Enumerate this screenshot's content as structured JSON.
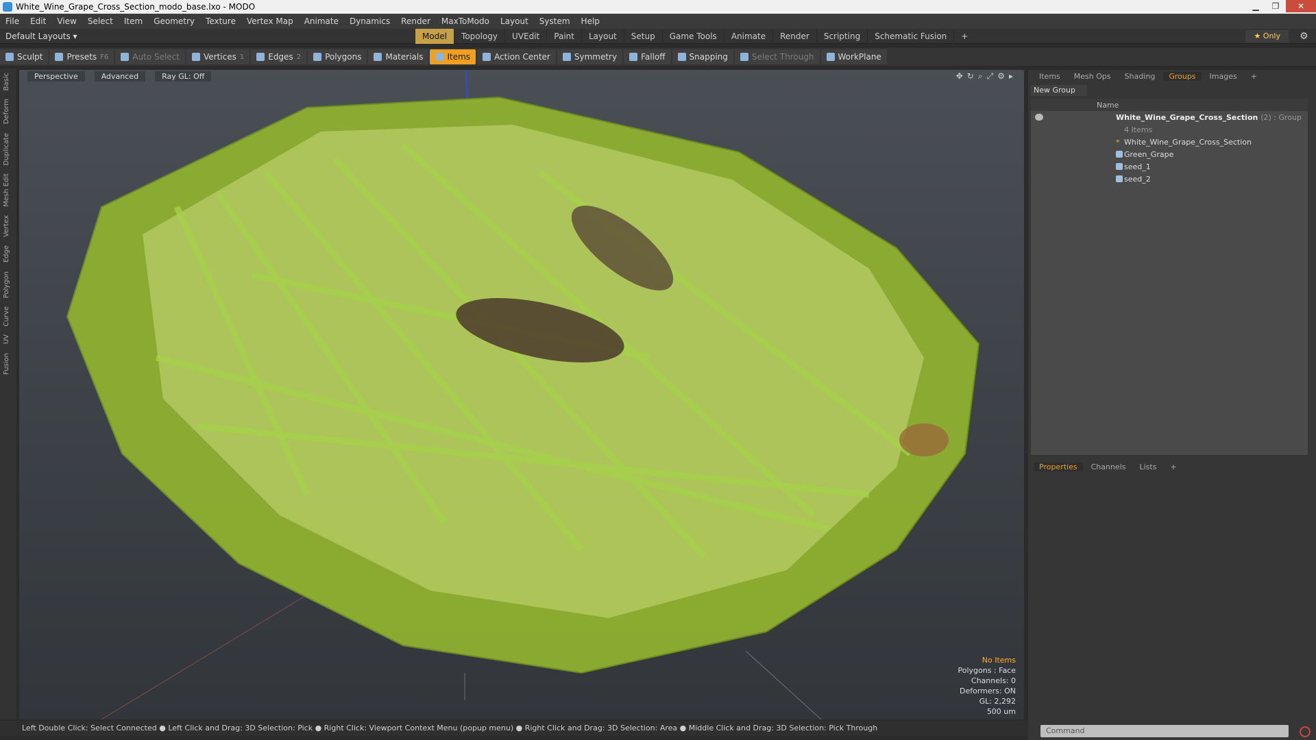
{
  "window": {
    "title": "White_Wine_Grape_Cross_Section_modo_base.lxo - MODO"
  },
  "menu": [
    "File",
    "Edit",
    "View",
    "Select",
    "Item",
    "Geometry",
    "Texture",
    "Vertex Map",
    "Animate",
    "Dynamics",
    "Render",
    "MaxToModo",
    "Layout",
    "System",
    "Help"
  ],
  "layout_selector": "Default Layouts",
  "mode_tabs": [
    "Model",
    "Topology",
    "UVEdit",
    "Paint",
    "Layout",
    "Setup",
    "Game Tools",
    "Animate",
    "Render",
    "Scripting",
    "Schematic Fusion"
  ],
  "only_label": "Only",
  "toolbar": {
    "sculpt": "Sculpt",
    "presets": "Presets",
    "presets_key": "F6",
    "auto_select": "Auto Select",
    "vertices": "Vertices",
    "vertices_key": "1",
    "edges": "Edges",
    "edges_key": "2",
    "polygons": "Polygons",
    "materials": "Materials",
    "items": "Items",
    "action_center": "Action Center",
    "symmetry": "Symmetry",
    "falloff": "Falloff",
    "snapping": "Snapping",
    "select_through": "Select Through",
    "workplane": "WorkPlane"
  },
  "left_tabs": [
    "Basic",
    "Deform",
    "Duplicate",
    "Mesh Edit",
    "Vertex",
    "Edge",
    "Polygon",
    "Curve",
    "UV",
    "Fusion"
  ],
  "viewport": {
    "view": "Perspective",
    "shading": "Advanced",
    "raygl": "Ray GL: Off",
    "info": [
      "No Items",
      "Polygons : Face",
      "Channels: 0",
      "Deformers: ON",
      "GL: 2,292",
      "500 um"
    ]
  },
  "status_bar": "Left Double Click: Select Connected ● Left Click and Drag: 3D Selection: Pick ● Right Click: Viewport Context Menu (popup menu) ● Right Click and Drag: 3D Selection: Area ● Middle Click and Drag: 3D Selection: Pick Through",
  "right_tabs": [
    "Items",
    "Mesh Ops",
    "Shading",
    "Groups",
    "Images"
  ],
  "new_group": "New Group",
  "groups": {
    "column_name": "Name",
    "group_name": "White_Wine_Grape_Cross_Section",
    "group_suffix": "(2) : Group",
    "group_count": "4 Items",
    "items": [
      "White_Wine_Grape_Cross_Section",
      "Green_Grape",
      "seed_1",
      "seed_2"
    ]
  },
  "bottom_tabs": [
    "Properties",
    "Channels",
    "Lists"
  ],
  "command_placeholder": "Command",
  "colors": {
    "accent": "#f0a020",
    "tab_active": "#c7a14a",
    "grape": "#a6c936"
  }
}
